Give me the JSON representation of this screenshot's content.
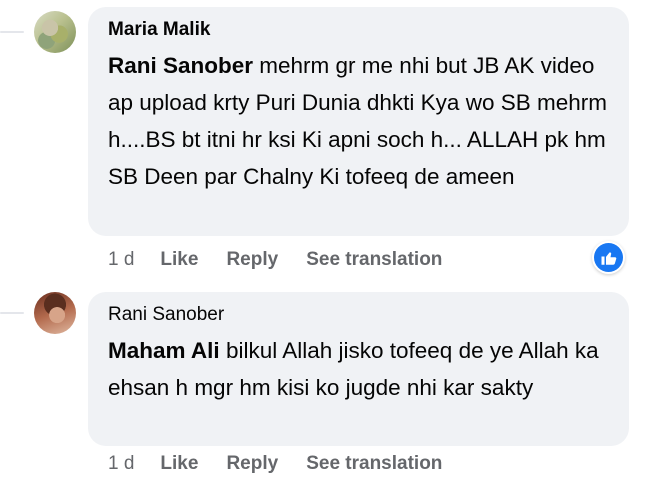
{
  "colors": {
    "bubble_bg": "#f0f2f5",
    "secondary_text": "#65676b",
    "like_blue": "#1877f2"
  },
  "comments": [
    {
      "author": "Maria Malik",
      "avatar_icon": "profile-photo",
      "mention": "Rani Sanober",
      "text": " mehrm gr me nhi but JB AK video ap upload krty Puri Dunia dhkti Kya wo SB mehrm h....BS bt itni hr ksi Ki apni soch h... ALLAH pk hm SB Deen par Chalny Ki tofeeq de ameen",
      "time": "1 d",
      "like_label": "Like",
      "reply_label": "Reply",
      "translate_label": "See translation",
      "reaction_icon": "thumbs-up-icon"
    },
    {
      "author": "Rani Sanober",
      "avatar_icon": "profile-photo",
      "mention": "Maham Ali",
      "text": " bilkul Allah jisko tofeeq de ye Allah ka ehsan h mgr hm kisi ko jugde nhi kar sakty",
      "time": "1 d",
      "like_label": "Like",
      "reply_label": "Reply",
      "translate_label": "See translation"
    }
  ]
}
